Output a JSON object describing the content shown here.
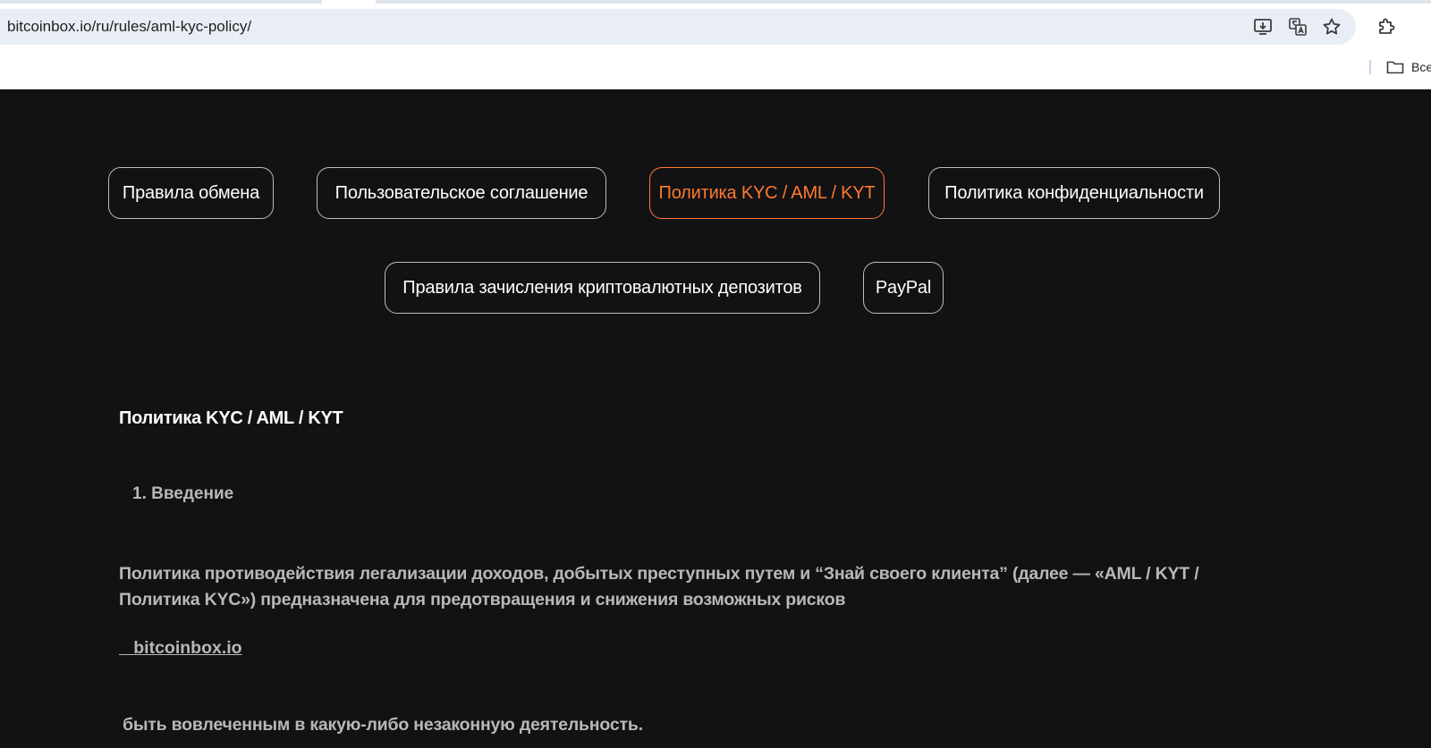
{
  "browser": {
    "url": "bitcoinbox.io/ru/rules/aml-kyc-policy/",
    "toolbar_icons": [
      "install-app-icon",
      "translate-icon",
      "bookmark-star-icon",
      "extensions-icon"
    ],
    "bookmarks_folder_label": "Все"
  },
  "nav": {
    "tabs": [
      {
        "label": "Правила обмена",
        "active": false
      },
      {
        "label": "Пользовательское соглашение",
        "active": false
      },
      {
        "label": "Политика KYC / AML / KYT",
        "active": true
      },
      {
        "label": "Политика конфиденциальности",
        "active": false
      },
      {
        "label": "Правила зачисления криптовалютных депозитов",
        "active": false
      },
      {
        "label": "PayPal",
        "active": false
      }
    ],
    "active_color": "#ff7a2f",
    "border_color": "#bdbdbd"
  },
  "content": {
    "title": "Политика KYC / AML / KYT",
    "section_heading": "1. Введение",
    "paragraph": "Политика противодействия легализации доходов, добытых преступных путем и “Знай своего клиента” (далее — «AML / KYT / Политика KYC») предназначена для предотвращения и снижения возможных рисков",
    "link_text": "   bitcoinbox.io",
    "paragraph_2": "быть вовлеченным в какую-либо незаконную деятельность."
  },
  "colors": {
    "page_background": "#121214",
    "text_primary": "#ffffff",
    "text_secondary": "#b8b8b8",
    "accent": "#ff7a2f"
  }
}
